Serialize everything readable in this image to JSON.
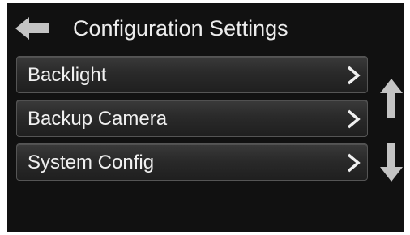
{
  "header": {
    "title": "Configuration Settings",
    "back_icon": "arrow-left-icon"
  },
  "menu": {
    "items": [
      {
        "label": "Backlight",
        "icon": "chevron-right-icon"
      },
      {
        "label": "Backup Camera",
        "icon": "chevron-right-icon"
      },
      {
        "label": "System Config",
        "icon": "chevron-right-icon"
      }
    ]
  },
  "scroll": {
    "up_icon": "arrow-up-icon",
    "down_icon": "arrow-down-icon"
  },
  "colors": {
    "background": "#111111",
    "text": "#f0f0f0",
    "icon": "#c4c4c4"
  }
}
